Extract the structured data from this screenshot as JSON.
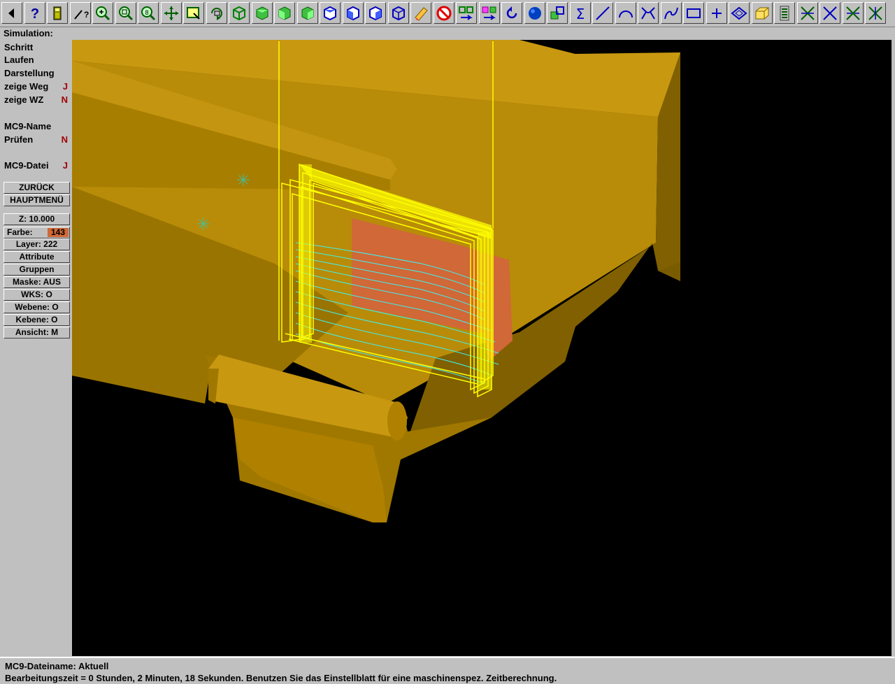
{
  "toolbar": {
    "buttons": [
      {
        "icon": "back-arrow-icon"
      },
      {
        "icon": "help-icon"
      },
      {
        "icon": "calculator-icon"
      },
      {
        "icon": "analyze-icon"
      },
      {
        "icon": "zoom-in-icon"
      },
      {
        "icon": "zoom-window-icon"
      },
      {
        "icon": "zoom-8-icon"
      },
      {
        "icon": "pan-icon"
      },
      {
        "icon": "select-window-icon"
      },
      {
        "icon": "rotate-view-icon"
      },
      {
        "icon": "view-iso-icon"
      },
      {
        "icon": "view-top-icon"
      },
      {
        "icon": "view-front-icon"
      },
      {
        "icon": "view-side-icon"
      },
      {
        "icon": "cube-blue-1-icon"
      },
      {
        "icon": "cube-blue-2-icon"
      },
      {
        "icon": "cube-blue-3-icon"
      },
      {
        "icon": "cube-outline-icon"
      },
      {
        "icon": "eraser-icon"
      },
      {
        "icon": "no-entry-icon"
      },
      {
        "icon": "transform-icon"
      },
      {
        "icon": "transform-color-icon"
      },
      {
        "icon": "undo-icon"
      },
      {
        "icon": "sphere-icon"
      },
      {
        "icon": "group-icon"
      },
      {
        "icon": "sum-icon"
      },
      {
        "icon": "line-icon"
      },
      {
        "icon": "arc-icon"
      },
      {
        "icon": "fillet-icon"
      },
      {
        "icon": "spline-icon"
      },
      {
        "icon": "rectangle-icon"
      },
      {
        "icon": "point-icon"
      },
      {
        "icon": "surface-icon"
      },
      {
        "icon": "solid-icon"
      },
      {
        "icon": "level-icon"
      },
      {
        "icon": "trim-icon"
      },
      {
        "icon": "break-icon"
      },
      {
        "icon": "join-icon"
      },
      {
        "icon": "delete-icon"
      }
    ]
  },
  "menu": {
    "title": "Simulation:",
    "items": [
      {
        "label": "Schritt",
        "flag": ""
      },
      {
        "label": "Laufen",
        "flag": ""
      },
      {
        "label": "Darstellung",
        "flag": ""
      },
      {
        "label": "zeige Weg",
        "flag": "J"
      },
      {
        "label": "zeige WZ",
        "flag": "N"
      },
      {
        "label": "MC9-Name",
        "flag": ""
      },
      {
        "label": "Prüfen",
        "flag": "N"
      },
      {
        "label": "MC9-Datei",
        "flag": "J"
      }
    ],
    "buttons": {
      "back": "ZURÜCK",
      "main": "HAUPTMENÜ"
    }
  },
  "params": {
    "z": "Z:  10.000",
    "farbe_label": "Farbe:",
    "farbe_value": "143",
    "layer": "Layer: 222",
    "attribute": "Attribute",
    "gruppen": "Gruppen",
    "maske": "Maske: AUS",
    "wks": "WKS:    O",
    "webene": "Webene:   O",
    "kebene": "Kebene:   O",
    "ansicht": "Ansicht:   M"
  },
  "status": {
    "line1": "MC9-Dateiname: Aktuell",
    "line2": "Bearbeitungszeit = 0 Stunden, 2 Minuten, 18 Sekunden. Benutzen Sie das Einstellblatt für eine maschinenspez. Zeitberechnung."
  },
  "colors": {
    "part_top": "#c89810",
    "part_front": "#b08000",
    "part_dark": "#806000",
    "toolpath": "#ffff00",
    "pocket": "#d06838",
    "cutter": "#40f0f0"
  }
}
